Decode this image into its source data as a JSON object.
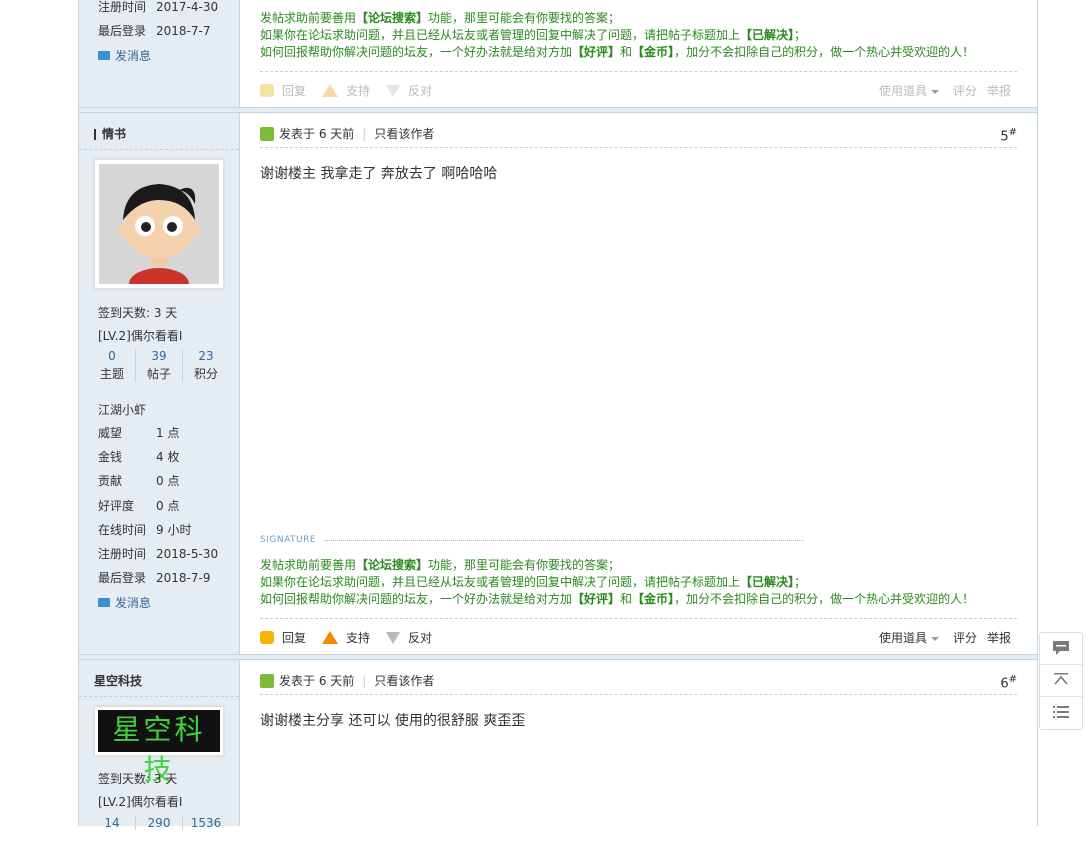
{
  "post_top": {
    "reg_label": "注册时间",
    "reg_value": "2017-4-30",
    "last_label": "最后登录",
    "last_value": "2018-7-7",
    "msg": "发消息",
    "sig_lines": [
      [
        "发帖求助前要善用",
        "【论坛搜索】",
        "功能，那里可能会有你要找的答案；"
      ],
      [
        "如果你在论坛求助问题，并且已经从坛友或者管理的回复中解决了问题，请把帖子标题加上",
        "【已解决】",
        "；"
      ],
      [
        "如何回报帮助你解决问题的坛友，一个好办法就是给对方加",
        "【好评】",
        "和",
        "【金币】",
        "，加分不会扣除自己的积分，做一个热心并受欢迎的人！"
      ]
    ],
    "actions": {
      "reply": "回复",
      "support": "支持",
      "oppose": "反对",
      "tools": "使用道具",
      "rate": "评分",
      "report": "举报"
    }
  },
  "post5": {
    "username": "情书",
    "avatar": "cartoon-boy-avatar",
    "signin": "签到天数: 3 天",
    "level": "[LV.2]偶尔看看I",
    "stats": [
      {
        "n": "0",
        "l": "主题"
      },
      {
        "n": "39",
        "l": "帖子"
      },
      {
        "n": "23",
        "l": "积分"
      }
    ],
    "title": "江湖小虾",
    "info": [
      {
        "k": "威望",
        "v": "1 点"
      },
      {
        "k": "金钱",
        "v": "4 枚"
      },
      {
        "k": "贡献",
        "v": "0 点"
      },
      {
        "k": "好评度",
        "v": "0 点"
      },
      {
        "k": "在线时间",
        "v": "9 小时"
      },
      {
        "k": "注册时间",
        "v": "2018-5-30"
      },
      {
        "k": "最后登录",
        "v": "2018-7-9"
      }
    ],
    "msg": "发消息",
    "posted": "发表于 6 天前",
    "only_author": "只看该作者",
    "floor": "5",
    "content": "谢谢楼主 我拿走了 奔放去了 啊哈哈哈",
    "sig_label": "SIGNATURE",
    "actions": {
      "reply": "回复",
      "support": "支持",
      "oppose": "反对",
      "tools": "使用道具",
      "rate": "评分",
      "report": "举报"
    }
  },
  "post6": {
    "username": "星空科技",
    "logo_text": "星空科技",
    "signin": "签到天数: 3 天",
    "level": "[LV.2]偶尔看看I",
    "stats": [
      {
        "n": "14",
        "l": ""
      },
      {
        "n": "290",
        "l": ""
      },
      {
        "n": "1536",
        "l": ""
      }
    ],
    "posted": "发表于 6 天前",
    "only_author": "只看该作者",
    "floor": "6",
    "content": "谢谢楼主分享 还可以 使用的很舒服 爽歪歪"
  },
  "float_tools": [
    "comment-icon",
    "back-to-top-icon",
    "list-icon"
  ],
  "colors": {
    "sidebar": "#e5edf2",
    "border": "#c2d5e3",
    "link": "#336699",
    "sig_green": "#2a8a1e"
  }
}
